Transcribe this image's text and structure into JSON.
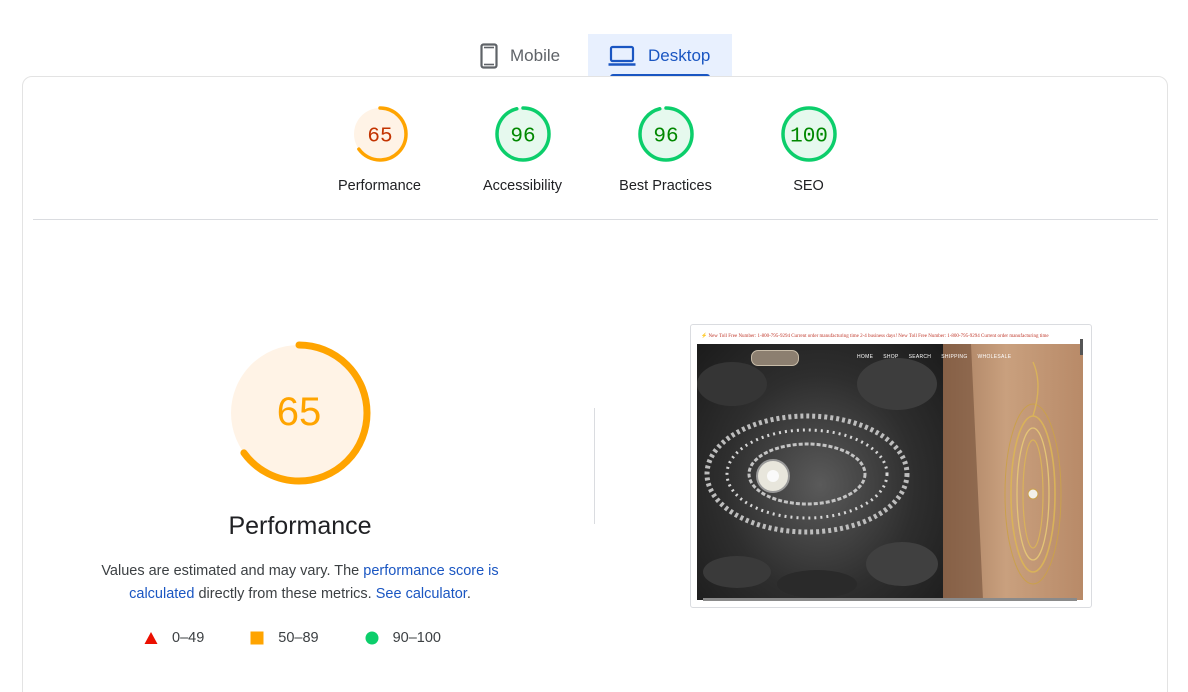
{
  "tabs": [
    {
      "label": "Mobile",
      "icon": "smartphone-icon",
      "selected": false
    },
    {
      "label": "Desktop",
      "icon": "laptop-icon",
      "selected": true
    }
  ],
  "categories": [
    {
      "label": "Performance",
      "score": "65",
      "level": "average"
    },
    {
      "label": "Accessibility",
      "score": "96",
      "level": "pass"
    },
    {
      "label": "Best Practices",
      "score": "96",
      "level": "pass"
    },
    {
      "label": "SEO",
      "score": "100",
      "level": "pass"
    }
  ],
  "performance": {
    "score": "65",
    "title": "Performance",
    "desc_prefix": "Values are estimated and may vary. The ",
    "desc_link1": "performance score is calculated",
    "desc_middle": " directly from these metrics. ",
    "desc_link2": "See calculator",
    "desc_suffix": "."
  },
  "legend": [
    {
      "range": "0–49",
      "shape": "triangle",
      "color": "#eb0f00"
    },
    {
      "range": "50–89",
      "shape": "square",
      "color": "#ffa400"
    },
    {
      "range": "90–100",
      "shape": "circle",
      "color": "#0cce6b"
    }
  ],
  "thumbnail": {
    "ticker": "⚡ New Toll Free Number: 1-800-795-9294     Current order manufacturing time 2-4 business days!   New Toll Free Number: 1-800-795-9294     Current order manufacturing time",
    "nav": [
      "HOME",
      "SHOP",
      "SEARCH",
      "SHIPPING",
      "WHOLESALE"
    ]
  },
  "colors": {
    "pass": "#0cce6b",
    "pass_text": "#008800",
    "pass_bg": "#e6f9ee",
    "average": "#ffa400",
    "average_text": "#c33300",
    "average_bg": "#fff3e6",
    "accent": "#1a56c2"
  }
}
